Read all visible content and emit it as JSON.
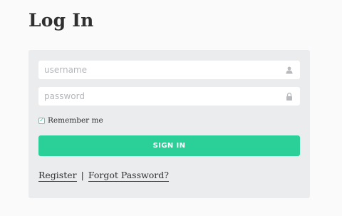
{
  "page": {
    "title": "Log In"
  },
  "form": {
    "username": {
      "placeholder": "username",
      "value": "",
      "icon": "user-icon"
    },
    "password": {
      "placeholder": "password",
      "value": "",
      "icon": "lock-icon"
    },
    "remember": {
      "label": "Remember me",
      "checked": true
    },
    "submit_label": "SIGN IN",
    "links": {
      "register": "Register",
      "separator": "|",
      "forgot": "Forgot Password?"
    }
  },
  "colors": {
    "accent": "#2bcf98",
    "panel_bg": "#ebecee",
    "page_bg": "#fafafb",
    "icon": "#b8babd"
  }
}
